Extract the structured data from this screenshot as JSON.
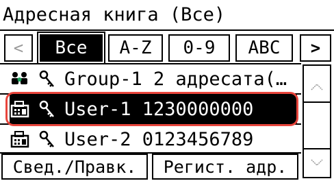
{
  "header": {
    "title": "Адресная книга (Все)"
  },
  "tabs": {
    "prev_icon": "chevron-left-icon",
    "prev_symbol": "<",
    "items": [
      {
        "label": "Все",
        "active": true
      },
      {
        "label": "A-Z",
        "active": false
      },
      {
        "label": "0-9",
        "active": false
      },
      {
        "label": "ABC",
        "active": false
      }
    ],
    "next_icon": "chevron-right-icon",
    "next_symbol": ">"
  },
  "list": {
    "items": [
      {
        "icon": "group-icon",
        "key_icon": "key-icon",
        "text": "Group-1 2 адресата(…",
        "selected": false
      },
      {
        "icon": "fax-icon",
        "key_icon": "key-icon",
        "text": "User-1 1230000000",
        "selected": true
      },
      {
        "icon": "fax-icon",
        "key_icon": "key-icon",
        "text": "User-2 0123456789",
        "selected": false
      }
    ]
  },
  "scroll": {
    "up_icon": "scroll-up-icon",
    "down_icon": "scroll-down-icon"
  },
  "footer": {
    "details_label": "Свед./Правк.",
    "register_label": "Регист. адр."
  },
  "colors": {
    "highlight": "#e8453c",
    "disabled": "#9a9a9a"
  }
}
